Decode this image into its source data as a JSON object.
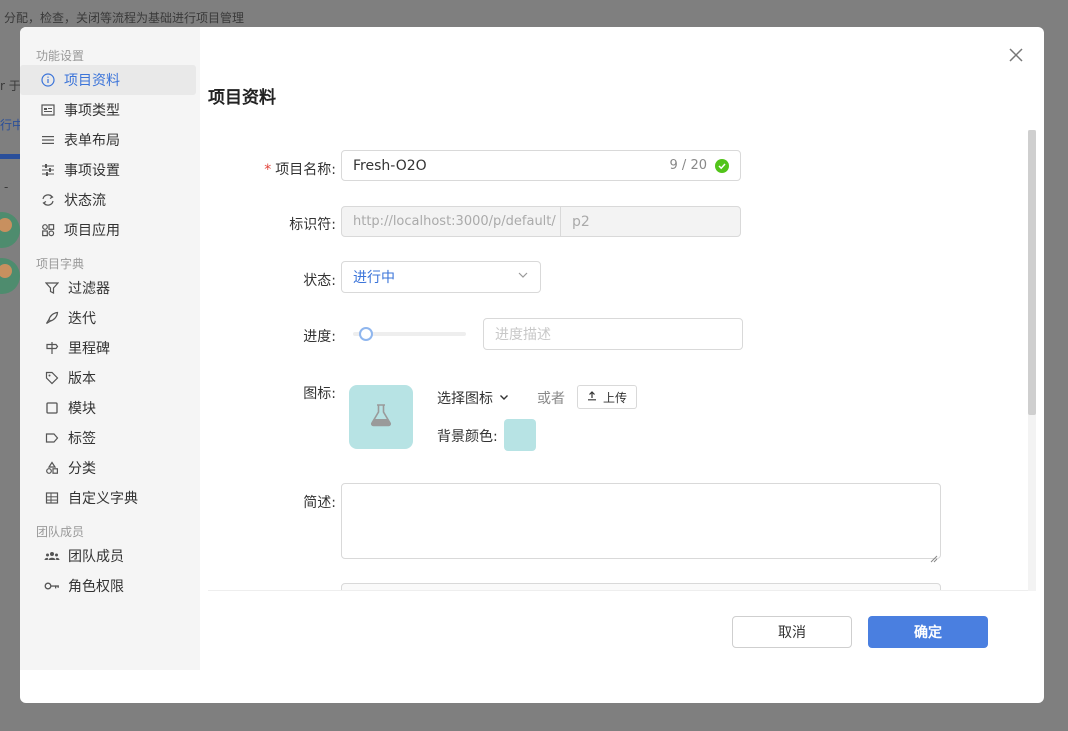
{
  "background": {
    "header_text": "分配，检查，关闭等流程为基础进行项目管理",
    "frag1": "r 于",
    "frag2": "行中",
    "frag3": "-"
  },
  "sidebar": {
    "groups": [
      {
        "title": "功能设置",
        "items": [
          {
            "label": "项目资料",
            "icon": "info-icon",
            "active": true
          },
          {
            "label": "事项类型",
            "icon": "type-icon"
          },
          {
            "label": "表单布局",
            "icon": "layout-icon"
          },
          {
            "label": "事项设置",
            "icon": "settings-icon"
          },
          {
            "label": "状态流",
            "icon": "flow-icon"
          },
          {
            "label": "项目应用",
            "icon": "apps-icon"
          }
        ]
      },
      {
        "title": "项目字典",
        "items": [
          {
            "label": "过滤器",
            "icon": "filter-icon"
          },
          {
            "label": "迭代",
            "icon": "rocket-icon"
          },
          {
            "label": "里程碑",
            "icon": "milestone-icon"
          },
          {
            "label": "版本",
            "icon": "tag-icon"
          },
          {
            "label": "模块",
            "icon": "module-icon"
          },
          {
            "label": "标签",
            "icon": "label-icon"
          },
          {
            "label": "分类",
            "icon": "category-icon"
          },
          {
            "label": "自定义字典",
            "icon": "table-icon"
          }
        ]
      },
      {
        "title": "团队成员",
        "items": [
          {
            "label": "团队成员",
            "icon": "team-icon"
          },
          {
            "label": "角色权限",
            "icon": "key-icon"
          }
        ]
      }
    ]
  },
  "page_title": "项目资料",
  "form": {
    "name": {
      "label": "项目名称:",
      "required_mark": "*",
      "value": "Fresh-O2O",
      "counter": "9 / 20"
    },
    "identifier": {
      "label": "标识符:",
      "prefix": "http://localhost:3000/p/default/",
      "value": "p2"
    },
    "status": {
      "label": "状态:",
      "value": "进行中"
    },
    "progress": {
      "label": "进度:",
      "value": 0,
      "placeholder": "进度描述"
    },
    "icon": {
      "label": "图标:",
      "choose_label": "选择图标",
      "or_label": "或者",
      "upload_label": "上传",
      "bg_color_label": "背景颜色:",
      "bg_color": "#b7e3e4"
    },
    "description": {
      "label": "简述:",
      "value": ""
    }
  },
  "footer": {
    "cancel_label": "取消",
    "ok_label": "确定"
  }
}
